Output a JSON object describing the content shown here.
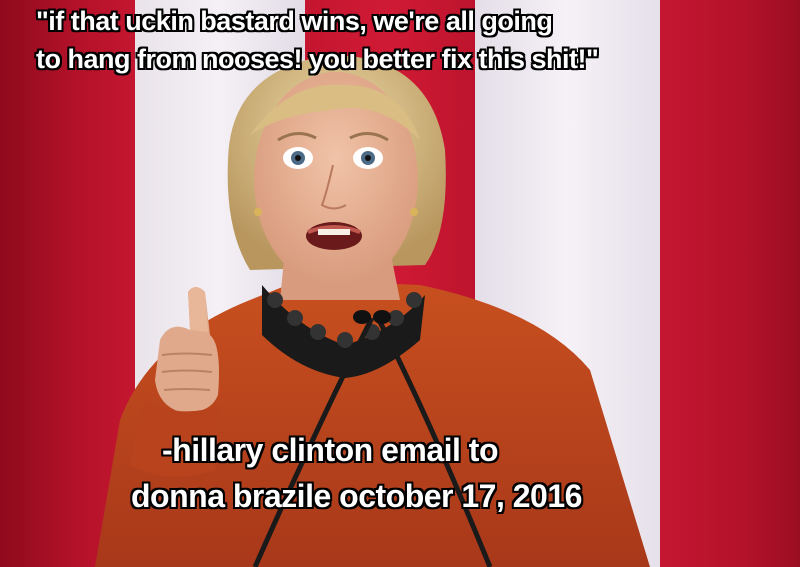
{
  "meme": {
    "top_caption": {
      "line1": "\"if that uckin bastard wins, we're all going",
      "line2": "to hang from nooses! you better fix this shit!\""
    },
    "bottom_caption": {
      "line1": "-hillary clinton email to",
      "line2": "donna brazile october 17, 2016"
    }
  },
  "colors": {
    "flag_red": "#c8102e",
    "flag_white": "#f2eef3",
    "jacket": "#c1441a",
    "caption_fill": "#ffffff",
    "caption_outline": "#000000"
  }
}
